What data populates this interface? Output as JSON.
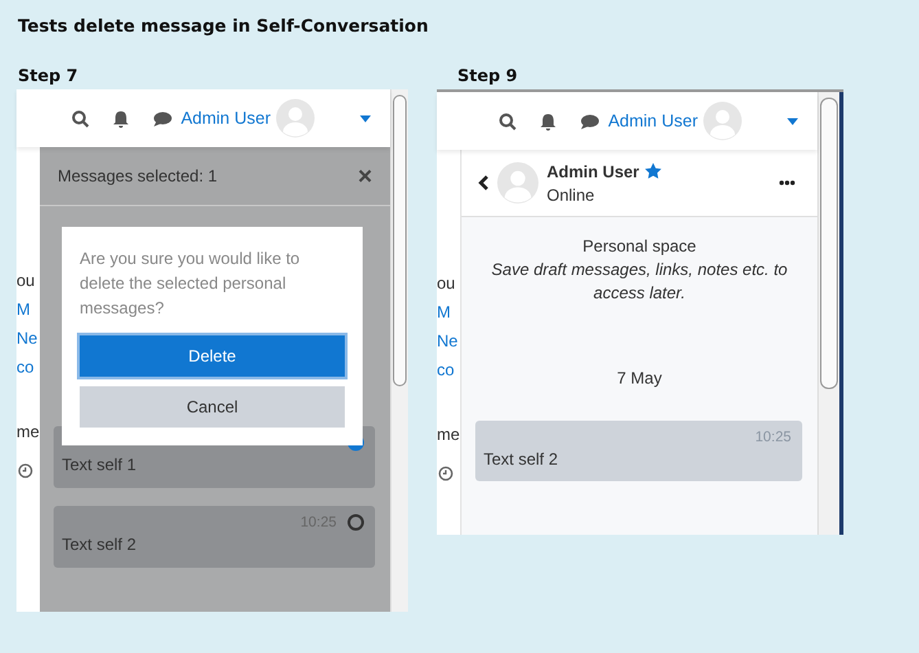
{
  "title": "Tests delete message in Self-Conversation",
  "steps": [
    {
      "kind": "selection",
      "label": "Step 7",
      "header": {
        "user": "Admin User"
      },
      "page_fragments": [
        "ou",
        "M",
        "Ne",
        "co",
        "me"
      ],
      "selection_bar": {
        "text": "Messages selected: 1",
        "close": "×"
      },
      "dialog": {
        "question": "Are you sure you would like to delete the selected personal messages?",
        "buttons": [
          "Delete",
          "Cancel"
        ]
      },
      "messages": [
        {
          "text": "Text self 1",
          "selected": true
        },
        {
          "time": "10:25",
          "text": "Text self 2",
          "selected": false
        }
      ]
    },
    {
      "kind": "conversation",
      "label": "Step 9",
      "header": {
        "user": "Admin User"
      },
      "page_fragments": [
        "ou",
        "M",
        "Ne",
        "co",
        "me"
      ],
      "contact": {
        "name": "Admin User",
        "starred": true,
        "status": "Online"
      },
      "intro": {
        "title": "Personal space",
        "note": "Save draft messages, links, notes etc. to access later."
      },
      "date": "7 May",
      "messages": [
        {
          "time": "10:25",
          "text": "Text self 2"
        }
      ]
    }
  ]
}
